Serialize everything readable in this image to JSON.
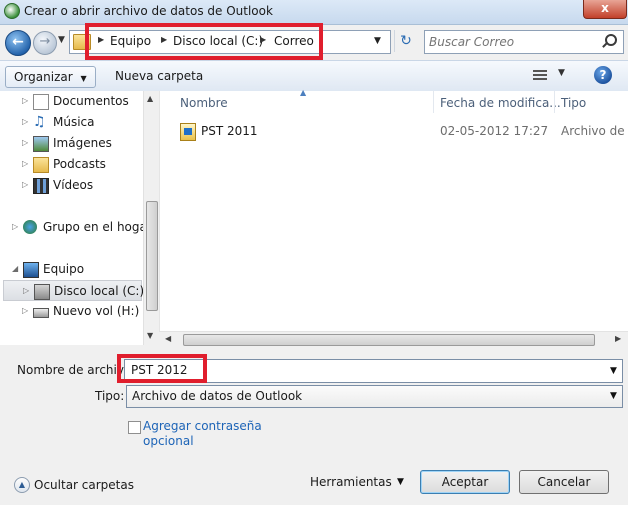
{
  "window": {
    "title": "Crear o abrir archivo de datos de Outlook",
    "close": "x"
  },
  "address": {
    "crumbs": [
      "Equipo",
      "Disco local (C:)",
      "Correo"
    ],
    "search_placeholder": "Buscar Correo"
  },
  "toolbar": {
    "organize": "Organizar",
    "new_folder": "Nueva carpeta"
  },
  "nav": {
    "items": [
      {
        "label": "Documentos"
      },
      {
        "label": "Música"
      },
      {
        "label": "Imágenes"
      },
      {
        "label": "Podcasts"
      },
      {
        "label": "Vídeos"
      },
      {
        "label": "Grupo en el hogar"
      },
      {
        "label": "Equipo"
      },
      {
        "label": "Disco local (C:)"
      },
      {
        "label": "Nuevo vol (H:)"
      }
    ]
  },
  "files": {
    "columns": [
      "Nombre",
      "Fecha de modifica...",
      "Tipo"
    ],
    "rows": [
      {
        "name": "PST 2011",
        "date": "02-05-2012 17:27",
        "type": "Archivo de d"
      }
    ]
  },
  "form": {
    "filename_label": "Nombre de archivo:",
    "filename_value": "PST 2012",
    "type_label": "Tipo:",
    "type_value": "Archivo de datos de Outlook",
    "password_link": "Agregar contraseña opcional"
  },
  "footer": {
    "hide_folders": "Ocultar carpetas",
    "tools": "Herramientas",
    "accept": "Aceptar",
    "cancel": "Cancelar"
  }
}
